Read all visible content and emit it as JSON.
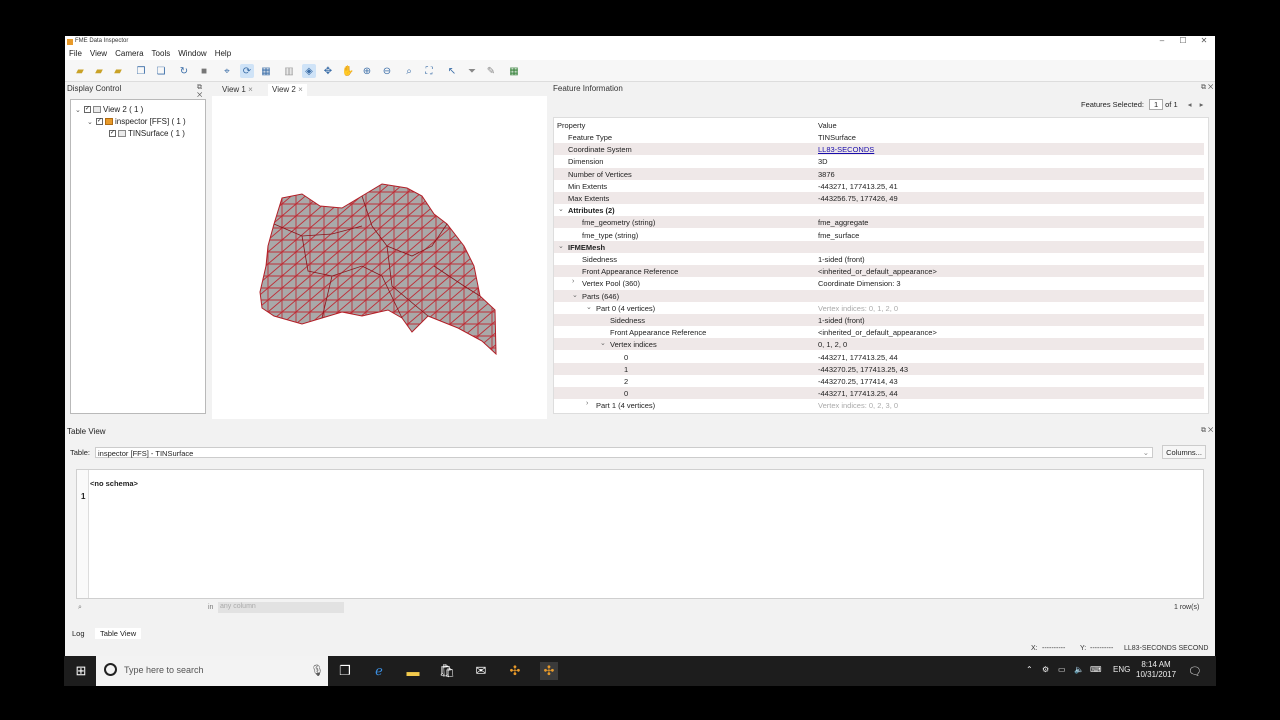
{
  "window": {
    "title": "FME Data Inspector",
    "controls": [
      "–",
      "☐",
      "✕"
    ]
  },
  "menu": [
    "File",
    "View",
    "Camera",
    "Tools",
    "Window",
    "Help"
  ],
  "toolbar_icons": [
    "open-folder-icon",
    "open-dataset-icon",
    "add-dataset-icon",
    "copy-icon",
    "paste-icon",
    "refresh-icon",
    "stop-icon",
    "select-icon",
    "orbit-icon",
    "table-icon",
    "split-icon",
    "select-active-icon",
    "pan-icon",
    "hand-icon",
    "zoom-in-icon",
    "zoom-out-icon",
    "zoom-to-icon",
    "zoom-extent-icon",
    "select-arrow-icon",
    "filter-icon",
    "measure-icon",
    "grid-icon"
  ],
  "display_control": {
    "title": "Display Control",
    "tree": [
      {
        "label": "View 2 ( 1 )",
        "level": 0
      },
      {
        "label": "inspector [FFS] ( 1 )",
        "level": 1
      },
      {
        "label": "TINSurface ( 1 )",
        "level": 2
      }
    ]
  },
  "view_tabs": [
    "View 1",
    "View 2"
  ],
  "feature_info": {
    "title": "Feature Information",
    "features_selected_label": "Features Selected:",
    "features_selected_value": "1",
    "features_of": "of 1",
    "col_property": "Property",
    "col_value": "Value",
    "rows": [
      {
        "p": "Feature Type",
        "v": "TINSurface",
        "indent": 0
      },
      {
        "p": "Coordinate System",
        "v": "LL83-SECONDS",
        "indent": 0,
        "link": true
      },
      {
        "p": "Dimension",
        "v": "3D",
        "indent": 0
      },
      {
        "p": "Number of Vertices",
        "v": "3876",
        "indent": 0
      },
      {
        "p": "Min Extents",
        "v": "-443271, 177413.25, 41",
        "indent": 0
      },
      {
        "p": "Max Extents",
        "v": "-443256.75, 177426, 49",
        "indent": 0
      },
      {
        "p": "Attributes (2)",
        "v": "",
        "indent": 0,
        "bold": true,
        "chev": "⌄"
      },
      {
        "p": "fme_geometry (string)",
        "v": "fme_aggregate",
        "indent": 1
      },
      {
        "p": "fme_type (string)",
        "v": "fme_surface",
        "indent": 1
      },
      {
        "p": "IFMEMesh",
        "v": "",
        "indent": 0,
        "bold": true,
        "chev": "⌄"
      },
      {
        "p": "Sidedness",
        "v": "1-sided (front)",
        "indent": 1
      },
      {
        "p": "Front Appearance Reference",
        "v": "<inherited_or_default_appearance>",
        "indent": 1
      },
      {
        "p": "Vertex Pool (360)",
        "v": "Coordinate Dimension: 3",
        "indent": 1,
        "chev": "›"
      },
      {
        "p": "Parts (646)",
        "v": "",
        "indent": 1,
        "chev": "⌄"
      },
      {
        "p": "Part 0 (4 vertices)",
        "v": "Vertex indices: 0, 1, 2, 0",
        "indent": 2,
        "chev": "⌄",
        "muted": true
      },
      {
        "p": "Sidedness",
        "v": "1-sided (front)",
        "indent": 3
      },
      {
        "p": "Front Appearance Reference",
        "v": "<inherited_or_default_appearance>",
        "indent": 3
      },
      {
        "p": "Vertex indices",
        "v": "0, 1, 2, 0",
        "indent": 3,
        "chev": "⌄"
      },
      {
        "p": "0",
        "v": "-443271, 177413.25, 44",
        "indent": 4
      },
      {
        "p": "1",
        "v": "-443270.25, 177413.25, 43",
        "indent": 4
      },
      {
        "p": "2",
        "v": "-443270.25, 177414, 43",
        "indent": 4
      },
      {
        "p": "0",
        "v": "-443271, 177413.25, 44",
        "indent": 4
      },
      {
        "p": "Part 1 (4 vertices)",
        "v": "Vertex indices: 0, 2, 3, 0",
        "indent": 2,
        "chev": "›",
        "muted": true
      }
    ]
  },
  "table_view": {
    "title": "Table View",
    "table_label": "Table:",
    "table_value": "inspector [FFS] - TINSurface",
    "columns_button": "Columns...",
    "column_header": "<no schema>",
    "row_number": "1",
    "search_in": "in",
    "search_scope": "any column",
    "row_count": "1 row(s)"
  },
  "bottom_tabs": [
    "Log",
    "Table View"
  ],
  "status": {
    "x": "X:",
    "x_val": "----------",
    "y": "Y:",
    "y_val": "----------",
    "crs": "LL83-SECONDS SECOND"
  },
  "taskbar": {
    "search_placeholder": "Type here to search",
    "lang": "ENG",
    "time": "8:14 AM",
    "date": "10/31/2017"
  }
}
